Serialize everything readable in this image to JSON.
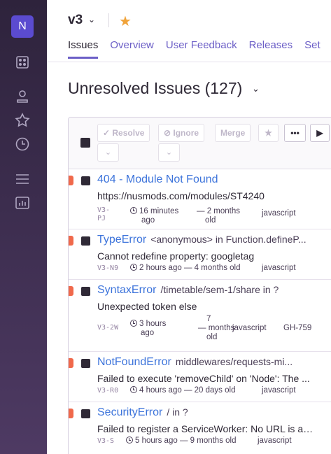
{
  "sidebar": {
    "org_initial": "N",
    "icons": [
      "dashboard-icon",
      "user-icon",
      "star-icon",
      "clock-icon",
      "menu-icon",
      "stats-icon"
    ]
  },
  "header": {
    "project": "v3",
    "tabs": [
      "Issues",
      "Overview",
      "User Feedback",
      "Releases",
      "Set"
    ]
  },
  "page": {
    "title": "Unresolved Issues",
    "count": "(127)"
  },
  "toolbar": {
    "resolve": "Resolve",
    "ignore": "Ignore",
    "merge": "Merge"
  },
  "issues": [
    {
      "type": "404 - Module Not Found",
      "location": "",
      "message": "https://nusmods.com/modules/ST4240",
      "short_id_1": "V3-",
      "short_id_2": "PJ",
      "time_1": "16 minutes",
      "time_2": "ago",
      "age_1": "— 2 months",
      "age_2": "old",
      "platform": "javascript"
    },
    {
      "type": "TypeError",
      "location": "<anonymous> in Function.defineP...",
      "message": "Cannot redefine property: googletag",
      "short_id": "V3-N9",
      "time": "2 hours ago",
      "age": "— 4 months old",
      "platform": "javascript"
    },
    {
      "type": "SyntaxError",
      "location": "/timetable/sem-1/share in ?",
      "message": "Unexpected token else",
      "short_id": "V3-2W",
      "time_1": "3 hours",
      "time_2": "ago",
      "age_1": "7",
      "age_2": "— months",
      "age_3": "old",
      "platform": "javascript",
      "extra": "GH-759"
    },
    {
      "type": "NotFoundError",
      "location": "middlewares/requests-mi...",
      "message": "Failed to execute 'removeChild' on 'Node': The ...",
      "short_id": "V3-R0",
      "time": "4 hours ago",
      "age": "— 20 days old",
      "platform": "javascript"
    },
    {
      "type": "SecurityError",
      "location": "/ in ?",
      "message": "Failed to register a ServiceWorker: No URL is as...",
      "short_id": "V3-S",
      "time": "5 hours ago",
      "age": "— 9 months old",
      "platform": "javascript"
    }
  ],
  "colors": {
    "accent": "#6c5fc7",
    "link": "#3d74db",
    "error_level": "#f0694b",
    "star": "#f0a33a"
  }
}
